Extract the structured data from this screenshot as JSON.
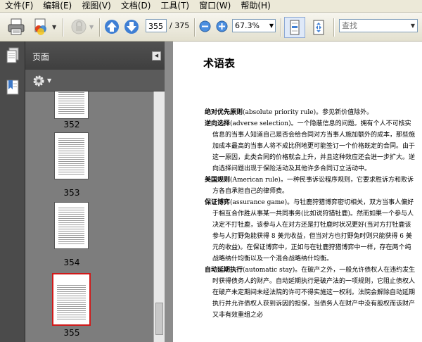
{
  "menubar": {
    "items": [
      "文件(F)",
      "编辑(E)",
      "视图(V)",
      "文档(D)",
      "工具(T)",
      "窗口(W)",
      "帮助(H)"
    ]
  },
  "toolbar": {
    "icons": [
      "print-icon",
      "create-pdf-icon",
      "secure-icon",
      "prev-page-icon",
      "next-page-icon",
      "zoom-out-icon",
      "zoom-in-icon",
      "fit-page-icon",
      "fullscreen-icon"
    ],
    "current_page": "355",
    "page_count": "/ 375",
    "zoom": "67.3%",
    "find_placeholder": "查找"
  },
  "panel": {
    "title": "页面",
    "options_icon": "gear-icon",
    "thumbnails": [
      {
        "label": "352",
        "selected": false
      },
      {
        "label": "353",
        "selected": false
      },
      {
        "label": "354",
        "selected": false
      },
      {
        "label": "355",
        "selected": true
      }
    ]
  },
  "document": {
    "heading": "术语表",
    "entries": [
      {
        "term": "绝对优先原则",
        "body": "(absolute priority rule)。参见新价值除外。"
      },
      {
        "term": "逆向选择",
        "body": "(adverse selection)。一个隐蔽信息的问题。拥有个人不可核实信息的当事人知道自己是否会给合同对方当事人施加额外的成本，那些施加成本最高的当事人将不成比例地更可能签订一个价格既定的合同。由于这一原因，此类合同的价格就会上升，并且这种效应还会进一步扩大。逆向选择问题出现于保险活动及其他许多合同订立活动中。"
      },
      {
        "term": "美国规则",
        "body": "(American rule)。一种民事诉讼程序规则，它要求胜诉方和败诉方各自承担自己的律师费。"
      },
      {
        "term": "保证博弈",
        "body": "(assurance game)。与牡鹿狩猎博弈密切相关，双方当事人偏好于相互合作胜从事某一共同事务(比如说狩猎牡鹿)。然而如果一个参与人决定不打牡鹿，该参与人在对方还是打牡鹿时状况更好(当对方打牡鹿该参与人打野兔能获得 8 美元收益，但当对方也打野兔时则只能获得 6 美元的收益)。在保证博弈中，正如与在牡鹿狩猎博弈中一样，存在两个纯战略纳什均衡以及一个混合战略纳什均衡。"
      },
      {
        "term": "自动延期执行",
        "body": "(automatic stay)。在破产之外，一般允许债权人在违约发生时获得债务人的财产。自动延期执行是破产法的一项规则，它阻止债权人在破产未定期间未经法院的许可不得实施这一权利。法院会解除自动延期执行并允许债权人获到诉因的担保，当债务人在财产中没有股权而该财产又非有效重组之必"
      }
    ]
  }
}
